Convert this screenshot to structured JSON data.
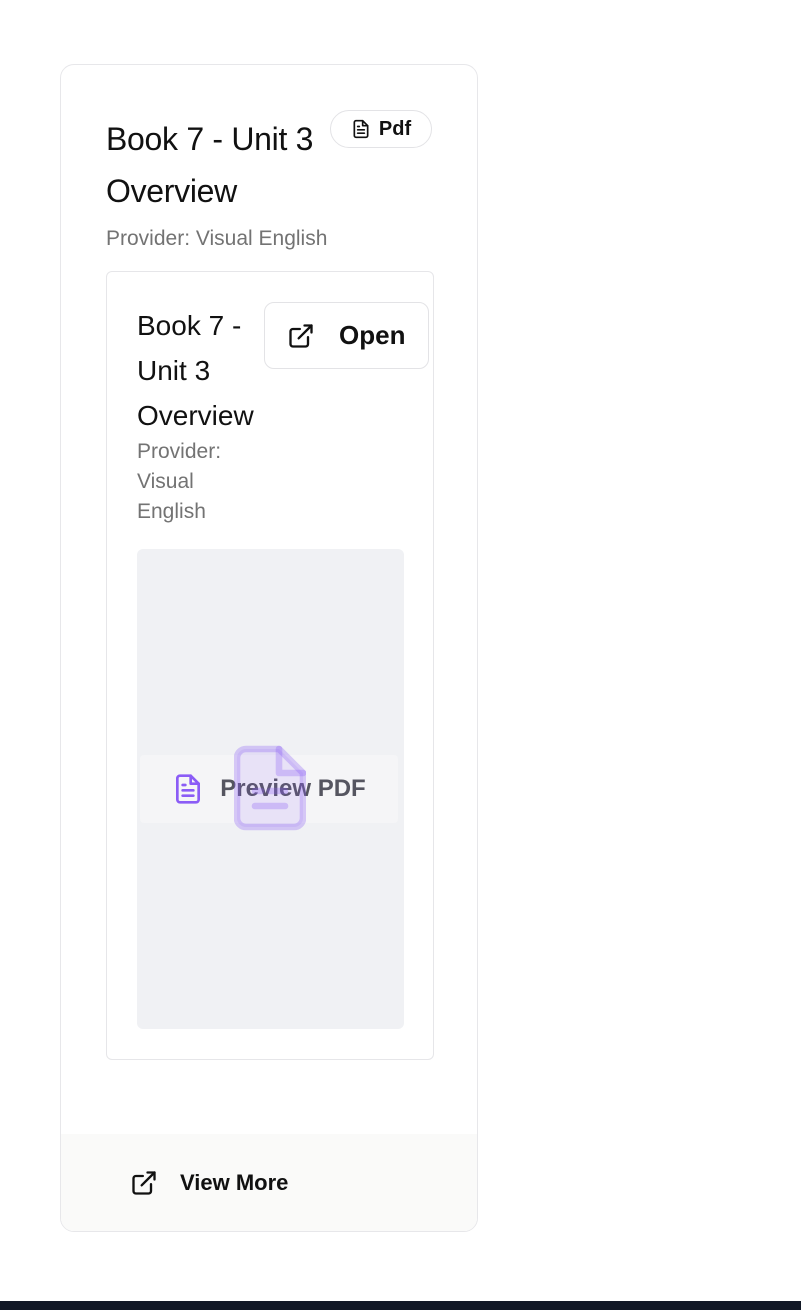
{
  "card": {
    "title": "Book 7 - Unit 3 Overview",
    "type_badge": {
      "label": "Pdf",
      "icon": "file-text-icon"
    },
    "provider": "Provider: Visual English"
  },
  "embed": {
    "title": "Book 7 - Unit 3 Overview",
    "provider": "Provider: Visual English",
    "open_button": {
      "label": "Open",
      "icon": "external-link-icon"
    },
    "preview": {
      "label": "Preview PDF",
      "icon": "file-text-icon",
      "accent": "#8b5cf6"
    }
  },
  "footer": {
    "label": "View More",
    "icon": "external-link-icon"
  },
  "colors": {
    "muted_text": "#737373",
    "preview_bg": "#f0f1f4",
    "footer_bg": "#fafaf9",
    "bottom_bar": "#121826"
  }
}
